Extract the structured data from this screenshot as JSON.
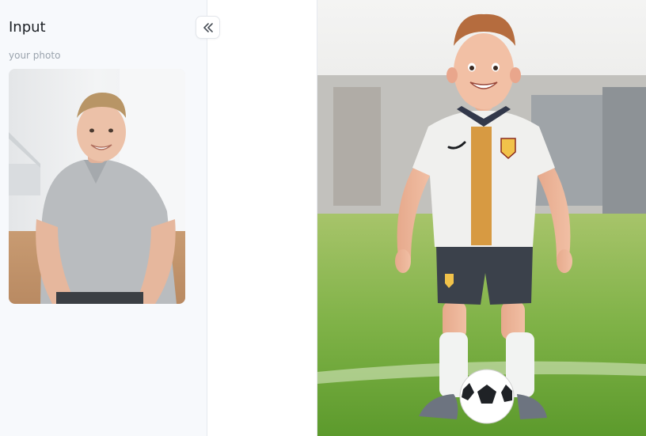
{
  "panel": {
    "title": "Input",
    "photo_label": "your photo"
  },
  "controls": {
    "collapse_icon": "double-chevron-left-icon"
  },
  "images": {
    "input_photo": "photo of smiling man in grey polo shirt",
    "output_image": "3D cartoon soccer player figurine on grass field with ball"
  }
}
